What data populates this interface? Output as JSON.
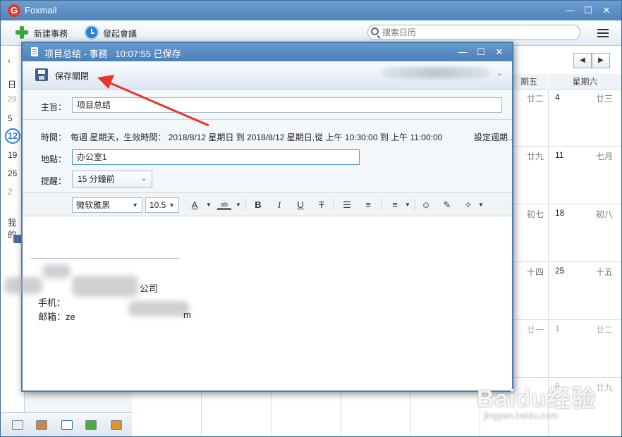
{
  "app": {
    "name": "Foxmail",
    "logo_letter": "G"
  },
  "main_toolbar": {
    "new_task": "新建事務",
    "start_meeting": "發起會議",
    "search_placeholder": "搜索日历"
  },
  "left_calendar": {
    "week_label": "日",
    "dates": [
      "29",
      "5",
      "12",
      "19",
      "26",
      "2"
    ],
    "today": "12",
    "section_label": "我的"
  },
  "calendar": {
    "weekday_headers": [
      "期五",
      "星期六"
    ],
    "rows": [
      {
        "fri_lunar": "廿二",
        "sat_date": "4",
        "sat_lunar": "廿三"
      },
      {
        "fri_lunar": "廿九",
        "sat_date": "11",
        "sat_lunar": "七月"
      },
      {
        "fri_lunar": "初七",
        "sat_date": "18",
        "sat_lunar": "初八"
      },
      {
        "fri_lunar": "十四",
        "sat_date": "25",
        "sat_lunar": "十五"
      },
      {
        "fri_lunar": "廿一",
        "sat_date": "1",
        "sat_lunar": "廿二"
      },
      {
        "fri_lunar": "",
        "sat_date": "8",
        "sat_lunar": "廿九"
      }
    ]
  },
  "dialog": {
    "title": "项目总结 - 事務",
    "saved_time": "10:07:55 已保存",
    "save_close": "保存關閉",
    "subject_label": "主旨：",
    "subject_value": "项目总结",
    "time_label": "時間：",
    "time_value": "每週 星期天，生效時間： 2018/8/12 星期日 到 2018/8/12 星期日,從 上午 10:30:00 到 上午 11:00:00",
    "set_repeat": "設定週期..",
    "location_label": "地點：",
    "location_value": "办公室1",
    "reminder_label": "提醒：",
    "reminder_value": "15 分鐘前",
    "font_name": "微软雅黑",
    "font_size": "10.5",
    "signature": {
      "company_suffix": "公司",
      "phone_label": "手机：",
      "email_label": "邮箱：ze",
      "email_tail": "m"
    }
  },
  "watermark": {
    "logo": "Baidu经验",
    "url": "jingyan.baidu.com"
  }
}
